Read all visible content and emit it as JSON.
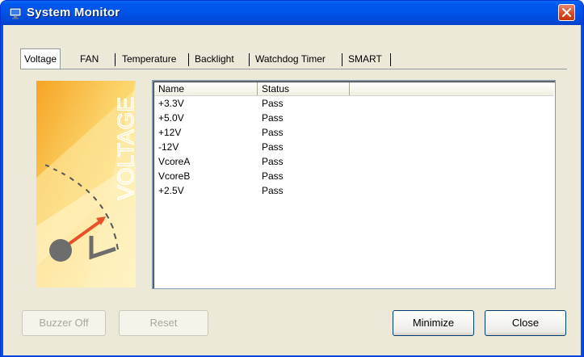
{
  "window": {
    "title": "System Monitor"
  },
  "tabs": [
    {
      "label": "Voltage",
      "active": true
    },
    {
      "label": "FAN",
      "active": false
    },
    {
      "label": "Temperature",
      "active": false
    },
    {
      "label": "Backlight",
      "active": false
    },
    {
      "label": "Watchdog Timer",
      "active": false
    },
    {
      "label": "SMART",
      "active": false
    }
  ],
  "illustration": {
    "caption": "VOLTAGE"
  },
  "list": {
    "columns": [
      "Name",
      "Status"
    ],
    "rows": [
      {
        "name": "+3.3V",
        "status": "Pass"
      },
      {
        "name": "+5.0V",
        "status": "Pass"
      },
      {
        "name": "+12V",
        "status": "Pass"
      },
      {
        "name": "-12V",
        "status": "Pass"
      },
      {
        "name": "VcoreA",
        "status": "Pass"
      },
      {
        "name": "VcoreB",
        "status": "Pass"
      },
      {
        "name": "+2.5V",
        "status": "Pass"
      }
    ]
  },
  "buttons": {
    "buzzer_off": "Buzzer Off",
    "reset": "Reset",
    "minimize": "Minimize",
    "close": "Close"
  },
  "colors": {
    "titlebar": "#0055e5",
    "face": "#ece9d8",
    "close": "#d8461f"
  }
}
